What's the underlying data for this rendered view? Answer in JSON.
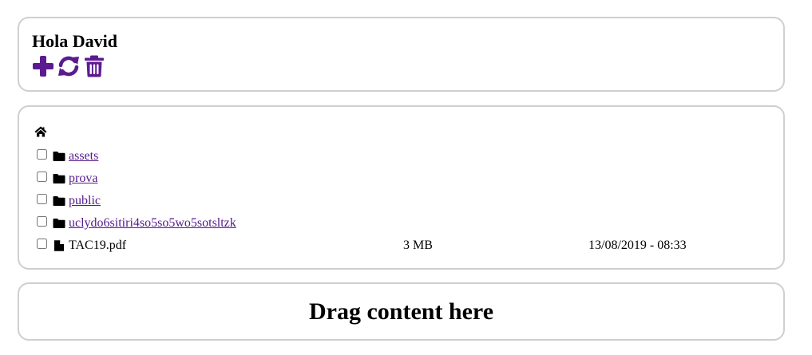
{
  "header": {
    "greeting": "Hola David",
    "toolbar": [
      {
        "action": "add",
        "icon": "plus-icon"
      },
      {
        "action": "refresh",
        "icon": "refresh-icon"
      },
      {
        "action": "delete",
        "icon": "trash-icon"
      }
    ]
  },
  "colors": {
    "accent": "#5b1a8f",
    "link": "#551a8b",
    "panel_border": "#cfcfcf"
  },
  "browser": {
    "home_icon": "home-icon",
    "items": [
      {
        "type": "folder",
        "name": "assets",
        "size": "",
        "date": "",
        "icon": "folder-icon"
      },
      {
        "type": "folder",
        "name": "prova",
        "size": "",
        "date": "",
        "icon": "folder-icon"
      },
      {
        "type": "folder",
        "name": "public",
        "size": "",
        "date": "",
        "icon": "folder-icon"
      },
      {
        "type": "folder",
        "name": "uclydo6sitiri4so5so5wo5sotsltzk",
        "size": "",
        "date": "",
        "icon": "folder-icon"
      },
      {
        "type": "file",
        "name": "TAC19.pdf",
        "size": "3 MB",
        "date": "13/08/2019 - 08:33",
        "icon": "file-icon"
      }
    ]
  },
  "dropzone": {
    "label": "Drag content here"
  }
}
